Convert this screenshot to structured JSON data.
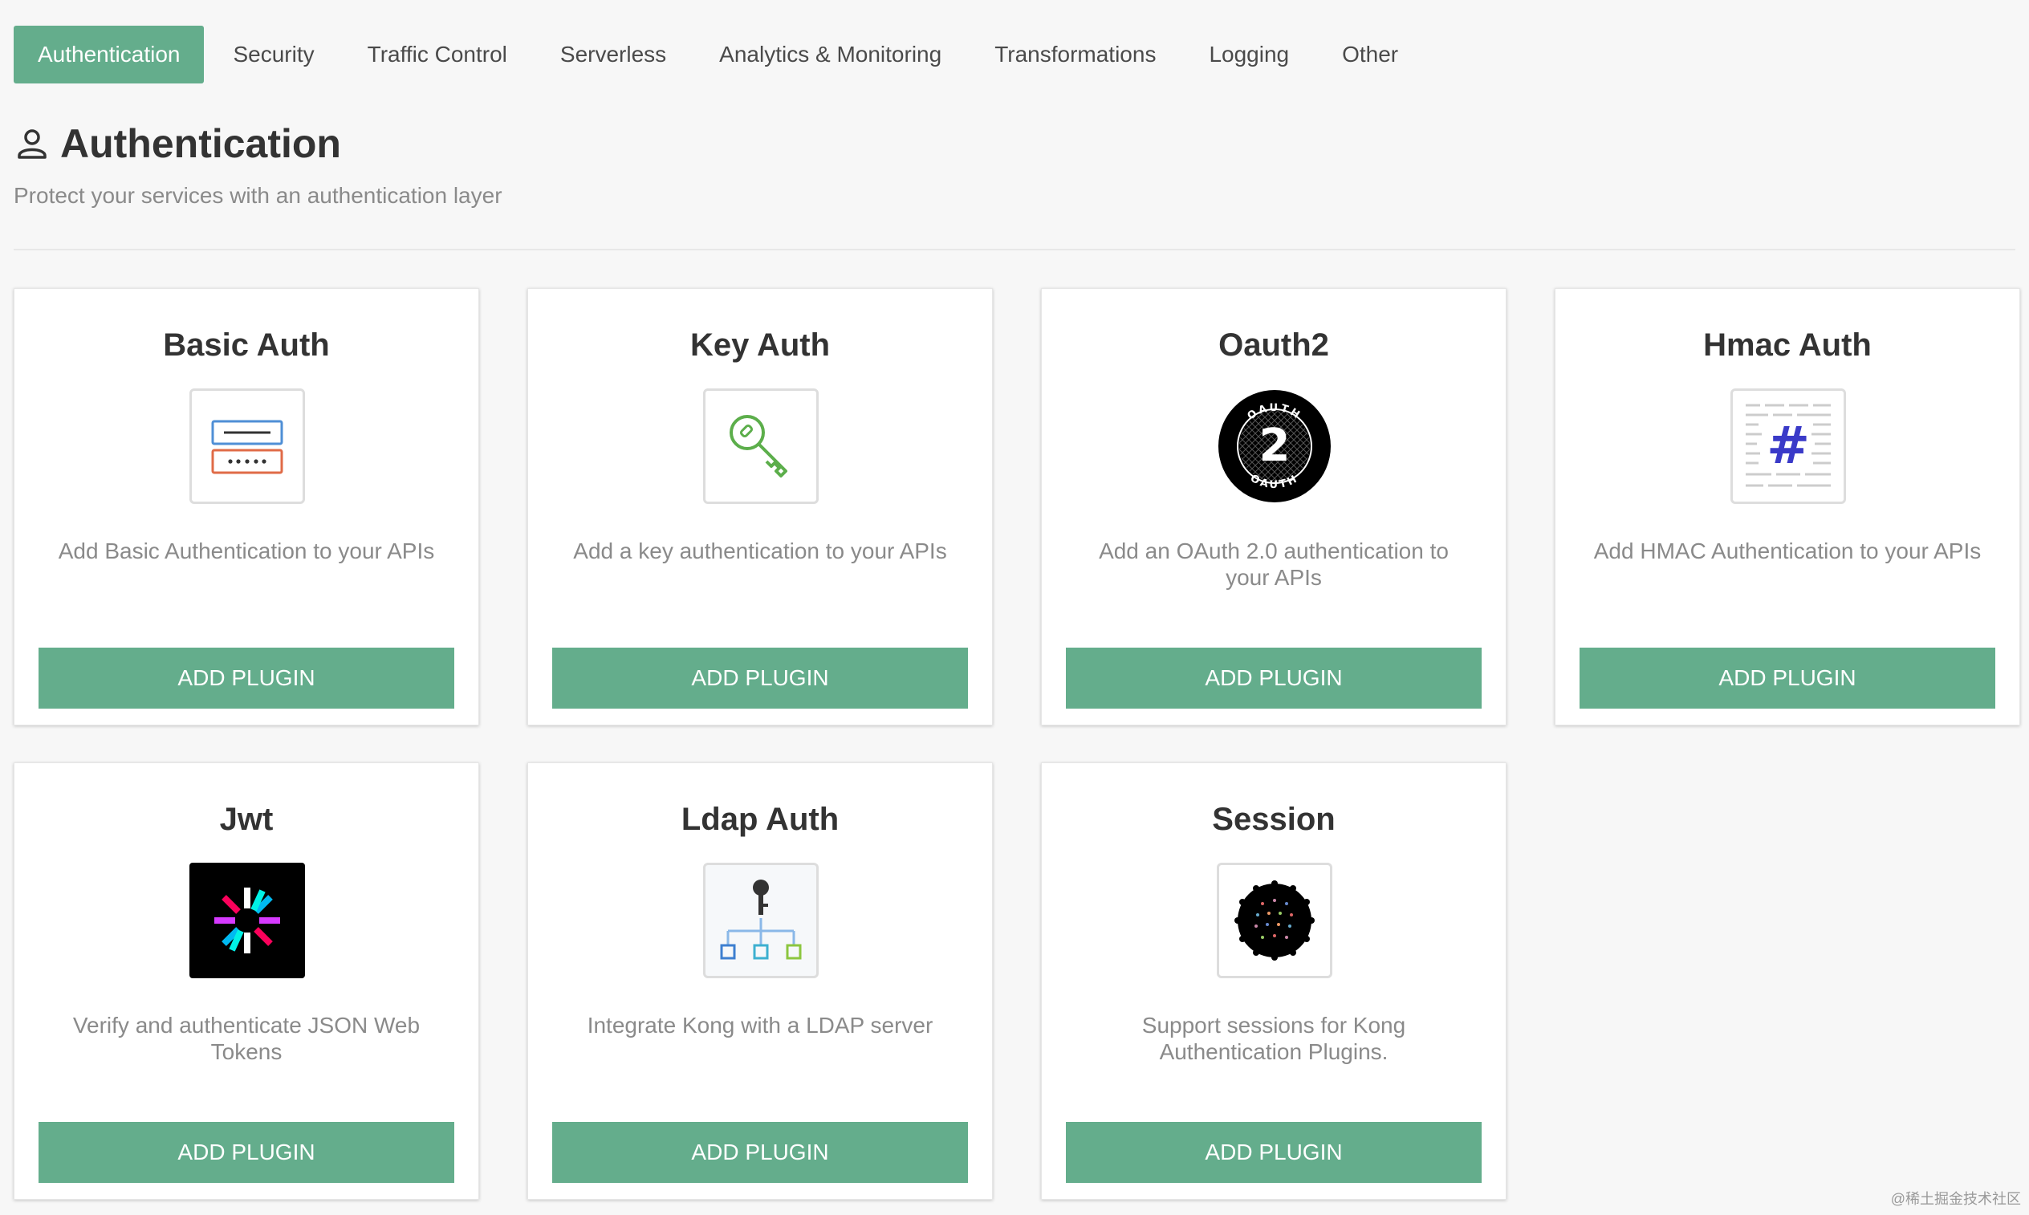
{
  "tabs": [
    {
      "label": "Authentication",
      "active": true
    },
    {
      "label": "Security"
    },
    {
      "label": "Traffic Control"
    },
    {
      "label": "Serverless"
    },
    {
      "label": "Analytics & Monitoring"
    },
    {
      "label": "Transformations"
    },
    {
      "label": "Logging"
    },
    {
      "label": "Other"
    }
  ],
  "section": {
    "icon": "person-icon",
    "title": "Authentication",
    "subtitle": "Protect your services with an authentication layer"
  },
  "cards": [
    {
      "title": "Basic Auth",
      "icon": "basic-auth-icon",
      "description": "Add Basic Authentication to your APIs",
      "button": "ADD PLUGIN"
    },
    {
      "title": "Key Auth",
      "icon": "key-icon",
      "description": "Add a key authentication to your APIs",
      "button": "ADD PLUGIN"
    },
    {
      "title": "Oauth2",
      "icon": "oauth2-icon",
      "icon_text": "2",
      "icon_ring_text": "OAUTH",
      "description": "Add an OAuth 2.0 authentication to your APIs",
      "button": "ADD PLUGIN"
    },
    {
      "title": "Hmac Auth",
      "icon": "hmac-hash-icon",
      "icon_text": "#",
      "description": "Add HMAC Authentication to your APIs",
      "button": "ADD PLUGIN"
    },
    {
      "title": "Jwt",
      "icon": "jwt-icon",
      "description": "Verify and authenticate JSON Web Tokens",
      "button": "ADD PLUGIN"
    },
    {
      "title": "Ldap Auth",
      "icon": "ldap-icon",
      "description": "Integrate Kong with a LDAP server",
      "button": "ADD PLUGIN"
    },
    {
      "title": "Session",
      "icon": "session-cookie-icon",
      "description": "Support sessions for Kong Authentication Plugins.",
      "button": "ADD PLUGIN"
    }
  ],
  "colors": {
    "accent": "#64ad8c",
    "background": "#f7f7f7",
    "card": "#ffffff"
  },
  "watermark": "@稀土掘金技术社区"
}
